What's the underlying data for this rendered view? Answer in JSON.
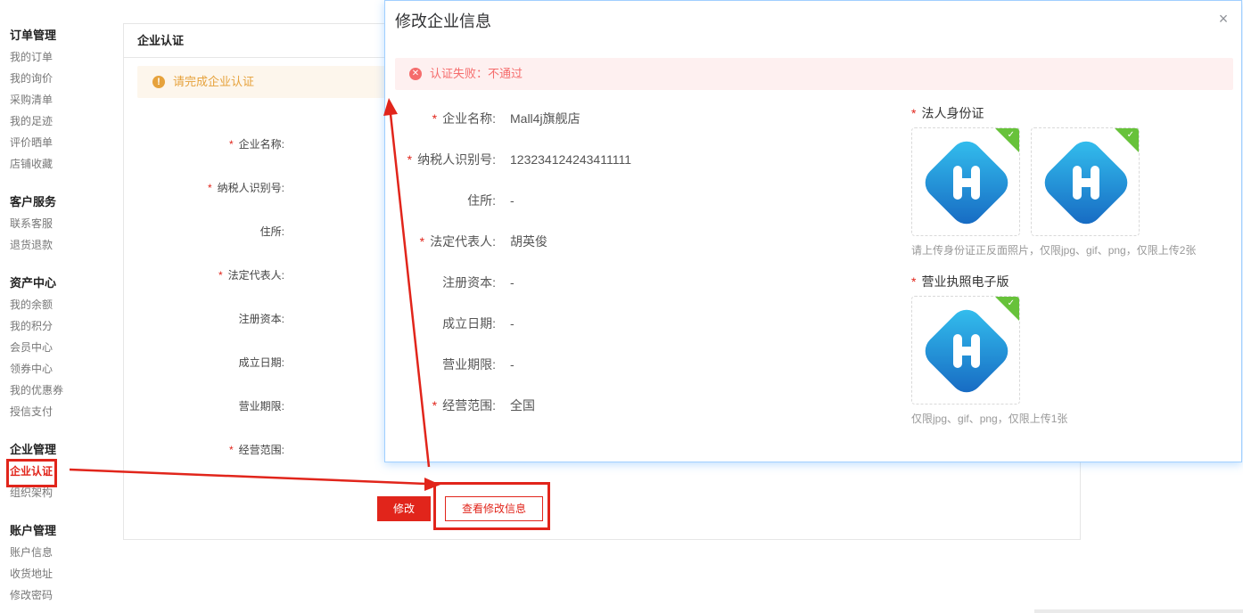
{
  "sidebar": {
    "groups": [
      {
        "title": "订单管理",
        "items": [
          "我的订单",
          "我的询价",
          "采购清单",
          "我的足迹",
          "评价晒单",
          "店铺收藏"
        ]
      },
      {
        "title": "客户服务",
        "items": [
          "联系客服",
          "退货退款"
        ]
      },
      {
        "title": "资产中心",
        "items": [
          "我的余额",
          "我的积分",
          "会员中心",
          "领券中心",
          "我的优惠券",
          "授信支付"
        ]
      },
      {
        "title": "企业管理",
        "items": [
          "企业认证",
          "组织架构"
        ]
      },
      {
        "title": "账户管理",
        "items": [
          "账户信息",
          "收货地址",
          "修改密码"
        ]
      }
    ]
  },
  "card": {
    "title": "企业认证",
    "notice": "请完成企业认证",
    "fields": [
      {
        "label": "企业名称:",
        "value": "-",
        "required": true
      },
      {
        "label": "纳税人识别号:",
        "value": "-",
        "required": true
      },
      {
        "label": "住所:",
        "value": "-",
        "required": false
      },
      {
        "label": "法定代表人:",
        "value": "-",
        "required": true
      },
      {
        "label": "注册资本:",
        "value": "-",
        "required": false
      },
      {
        "label": "成立日期:",
        "value": "-",
        "required": false
      },
      {
        "label": "营业期限:",
        "value": "-",
        "required": false
      },
      {
        "label": "经营范围:",
        "value": "-",
        "required": true
      }
    ],
    "modify_label": "修改",
    "view_label": "查看修改信息"
  },
  "modal": {
    "title": "修改企业信息",
    "close_glyph": "×",
    "alert": "认证失败：不通过",
    "fields": [
      {
        "label": "企业名称:",
        "value": "Mall4j旗舰店",
        "required": true
      },
      {
        "label": "纳税人识别号:",
        "value": "123234124243411111",
        "required": true
      },
      {
        "label": "住所:",
        "value": "-",
        "required": false
      },
      {
        "label": "法定代表人:",
        "value": "胡英俊",
        "required": true
      },
      {
        "label": "注册资本:",
        "value": "-",
        "required": false
      },
      {
        "label": "成立日期:",
        "value": "-",
        "required": false
      },
      {
        "label": "营业期限:",
        "value": "-",
        "required": false
      },
      {
        "label": "经营范围:",
        "value": "全国",
        "required": true
      }
    ],
    "id_card_title": "法人身份证",
    "id_card_hint": "请上传身份证正反面照片，仅限jpg、gif、png，仅限上传2张",
    "license_title": "营业执照电子版",
    "license_hint": "仅限jpg、gif、png，仅限上传1张"
  },
  "colors": {
    "accent": "#e1251b",
    "warning": "#e6a23c",
    "error": "#f56c6c",
    "success": "#67c23a"
  }
}
